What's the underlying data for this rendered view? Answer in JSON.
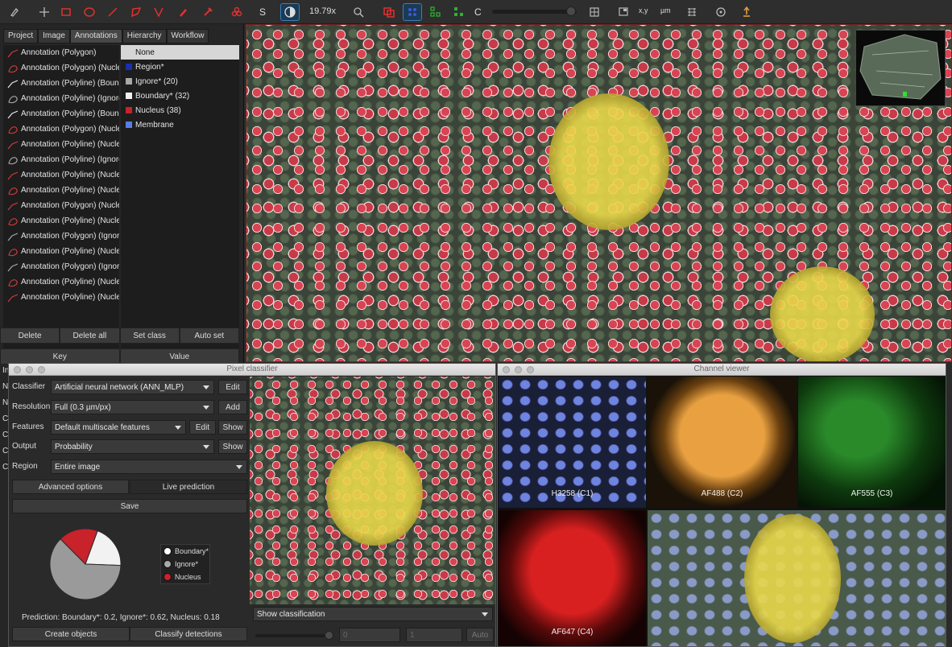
{
  "toolbar": {
    "zoom_value": "19.79x",
    "s_label": "S",
    "c_label": "C",
    "xy_label": "x,y",
    "scalebar_label": "µm",
    "icons": [
      "move-icon",
      "brush-icon",
      "rectangle-icon",
      "ellipse-icon",
      "line-icon",
      "polygon-icon",
      "polyline-icon",
      "wand-icon",
      "points-icon",
      "contrast-icon",
      "zoom-fit-icon",
      "show-annotations-icon",
      "show-tma-icon",
      "show-detections-icon",
      "fill-detections-icon",
      "grid-icon",
      "overview-icon",
      "scalebar-icon",
      "pixel-classification-icon"
    ]
  },
  "left_panel": {
    "tabs": [
      "Project",
      "Image",
      "Annotations",
      "Hierarchy",
      "Workflow"
    ],
    "active_tab": "Annotations",
    "annotations": [
      {
        "label": "Annotation (Polygon)",
        "color": "#d23a3a"
      },
      {
        "label": "Annotation (Polygon) (Nucle",
        "color": "#d23a3a"
      },
      {
        "label": "Annotation (Polyline) (Bound",
        "color": "#e8e8e8"
      },
      {
        "label": "Annotation (Polyline) (Ignore*)",
        "color": "#a8a8a8"
      },
      {
        "label": "Annotation (Polyline) (Bound",
        "color": "#e8e8e8"
      },
      {
        "label": "Annotation (Polygon) (Nucle",
        "color": "#d23a3a"
      },
      {
        "label": "Annotation (Polyline) (Nucle",
        "color": "#d23a3a"
      },
      {
        "label": "Annotation (Polyline) (Ignore",
        "color": "#a8a8a8"
      },
      {
        "label": "Annotation (Polyline) (Nucle",
        "color": "#d23a3a"
      },
      {
        "label": "Annotation (Polyline) (Nucle",
        "color": "#d23a3a"
      },
      {
        "label": "Annotation (Polygon) (Nucle",
        "color": "#d23a3a"
      },
      {
        "label": "Annotation (Polyline) (Nucle",
        "color": "#d23a3a"
      },
      {
        "label": "Annotation (Polygon) (Ignore",
        "color": "#a8a8a8"
      },
      {
        "label": "Annotation (Polyline) (Nucle",
        "color": "#d23a3a"
      },
      {
        "label": "Annotation (Polygon) (Ignore",
        "color": "#a8a8a8"
      },
      {
        "label": "Annotation (Polyline) (Nucle",
        "color": "#d23a3a"
      },
      {
        "label": "Annotation (Polyline) (Nucleus",
        "color": "#d23a3a"
      }
    ],
    "classes": [
      {
        "label": "None",
        "color": "",
        "selected": true
      },
      {
        "label": "Region*",
        "color": "#1a2fb0"
      },
      {
        "label": "Ignore* (20)",
        "color": "#a8a8a8"
      },
      {
        "label": "Boundary* (32)",
        "color": "#f0f0f0"
      },
      {
        "label": "Nucleus (38)",
        "color": "#c8222a"
      },
      {
        "label": "Membrane",
        "color": "#5a7de8"
      }
    ],
    "buttons_row1": [
      "Delete",
      "Delete all",
      "Set class",
      "Auto set"
    ],
    "table_header": [
      "Key",
      "Value"
    ],
    "side_letters": [
      "In",
      "N",
      "N",
      "C",
      "C",
      "C",
      "C"
    ]
  },
  "pixel_classifier": {
    "title": "Pixel classifier",
    "classifier_label": "Classifier",
    "classifier_value": "Artificial neural network (ANN_MLP)",
    "classifier_btn": "Edit",
    "resolution_label": "Resolution",
    "resolution_value": "Full (0.3 µm/px)",
    "resolution_btn": "Add",
    "features_label": "Features",
    "features_value": "Default multiscale features",
    "features_btn1": "Edit",
    "features_btn2": "Show",
    "output_label": "Output",
    "output_value": "Probability",
    "output_btn": "Show",
    "region_label": "Region",
    "region_value": "Entire image",
    "advanced": "Advanced options",
    "live": "Live prediction",
    "save": "Save",
    "legend": [
      {
        "label": "Boundary*",
        "color": "#ffffff"
      },
      {
        "label": "Ignore*",
        "color": "#aaaaaa"
      },
      {
        "label": "Nucleus",
        "color": "#c8222a"
      }
    ],
    "pie": [
      {
        "label": "Boundary*",
        "value": 0.2,
        "color": "#f2f2f2"
      },
      {
        "label": "Ignore*",
        "value": 0.62,
        "color": "#9a9a9a"
      },
      {
        "label": "Nucleus",
        "value": 0.18,
        "color": "#c8222a"
      }
    ],
    "prediction_text": "Prediction: Boundary*: 0.2, Ignore*: 0.62, Nucleus: 0.18",
    "create_objects": "Create objects",
    "classify_detections": "Classify detections",
    "show_classification": "Show classification",
    "spin1": "0",
    "spin2": "1",
    "auto": "Auto"
  },
  "channel_viewer": {
    "title": "Channel viewer",
    "channels": [
      {
        "label": "H3258 (C1)",
        "color": "#6f83e0"
      },
      {
        "label": "AF488 (C2)",
        "color": "#e8a040"
      },
      {
        "label": "AF555 (C3)",
        "color": "#2fb02f"
      },
      {
        "label": "AF647 (C4)",
        "color": "#d82020"
      }
    ]
  }
}
